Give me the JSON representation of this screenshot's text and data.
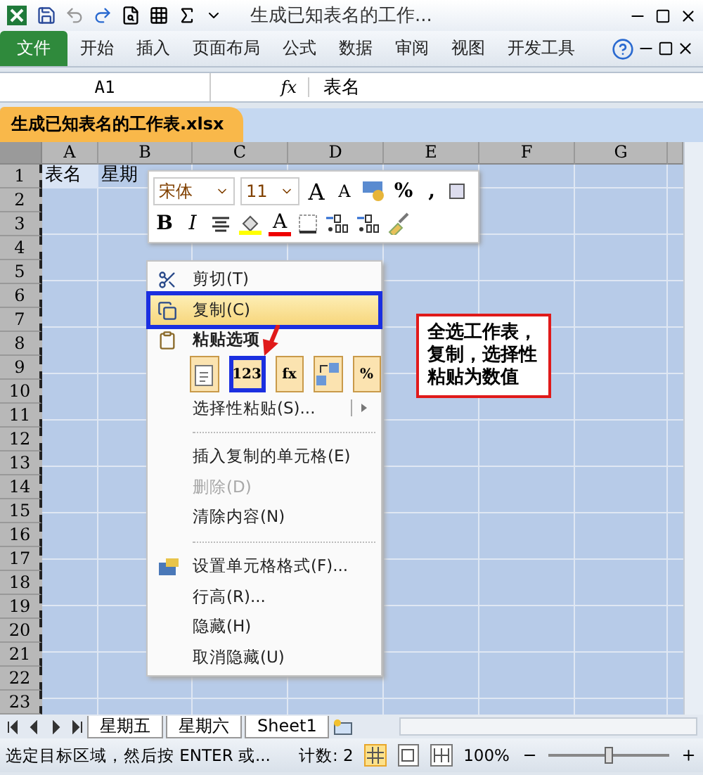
{
  "window": {
    "title": "生成已知表名的工作..."
  },
  "ribbon": {
    "tabs": [
      {
        "label": "文件",
        "kind": "file"
      },
      {
        "label": "开始",
        "kind": "tab"
      },
      {
        "label": "插入",
        "kind": "tab"
      },
      {
        "label": "页面布局",
        "kind": "tab"
      },
      {
        "label": "公式",
        "kind": "tab"
      },
      {
        "label": "数据",
        "kind": "tab"
      },
      {
        "label": "审阅",
        "kind": "tab"
      },
      {
        "label": "视图",
        "kind": "tab"
      },
      {
        "label": "开发工具",
        "kind": "tab"
      }
    ]
  },
  "formula_bar": {
    "name_box": "A1",
    "fx": "fx",
    "value": "表名"
  },
  "workbook_tab": {
    "title": "生成已知表名的工作表.xlsx"
  },
  "sheet": {
    "columns": [
      "A",
      "B",
      "C",
      "D",
      "E",
      "F",
      "G"
    ],
    "rows": [
      {
        "header": "1",
        "cells": [
          "表名",
          "星期"
        ]
      },
      {
        "header": "2"
      },
      {
        "header": "3"
      },
      {
        "header": "4"
      },
      {
        "header": "5"
      },
      {
        "header": "6"
      },
      {
        "header": "7"
      },
      {
        "header": "8"
      },
      {
        "header": "9"
      },
      {
        "header": "10"
      },
      {
        "header": "11"
      },
      {
        "header": "12"
      },
      {
        "header": "13"
      },
      {
        "header": "14"
      },
      {
        "header": "15"
      },
      {
        "header": "16"
      },
      {
        "header": "17"
      },
      {
        "header": "18"
      },
      {
        "header": "19"
      },
      {
        "header": "20"
      },
      {
        "header": "21"
      },
      {
        "header": "22"
      },
      {
        "header": "23"
      }
    ]
  },
  "mini_toolbar": {
    "font": "宋体",
    "size": "11",
    "row_1": [
      {
        "kind": "grow",
        "label": "A"
      },
      {
        "kind": "shrink",
        "label": "A"
      },
      {
        "kind": "accounting"
      },
      {
        "kind": "text",
        "label": "%"
      },
      {
        "kind": "text",
        "label": ","
      },
      {
        "kind": "cut"
      }
    ],
    "row_2": [
      {
        "kind": "bold",
        "label": "B"
      },
      {
        "kind": "italic",
        "label": "I"
      },
      {
        "kind": "center"
      },
      {
        "kind": "fill"
      },
      {
        "kind": "fontcolor",
        "label": "A"
      },
      {
        "kind": "border"
      },
      {
        "kind": "incdec"
      },
      {
        "kind": "decdec"
      },
      {
        "kind": "brush"
      }
    ]
  },
  "context_menu": {
    "items": [
      {
        "kind": "item",
        "label": "剪切(T)",
        "highlighted": false,
        "disabled": false
      },
      {
        "kind": "item",
        "label": "复制(C)",
        "highlighted": true,
        "disabled": false
      },
      {
        "kind": "header",
        "label": "粘贴选项"
      },
      {
        "kind": "paste_options",
        "options": [
          {
            "kind": "paste",
            "selected": false
          },
          {
            "kind": "values",
            "label": "123",
            "selected": true
          },
          {
            "kind": "formulas",
            "label": "fx",
            "selected": false
          },
          {
            "kind": "transpose",
            "selected": false
          },
          {
            "kind": "formatting",
            "label": "%",
            "selected": false
          }
        ]
      },
      {
        "kind": "submenu",
        "label": "选择性粘贴(S)...",
        "highlighted": false,
        "disabled": false
      },
      {
        "kind": "separator"
      },
      {
        "kind": "item",
        "label": "插入复制的单元格(E)",
        "highlighted": false,
        "disabled": false
      },
      {
        "kind": "item",
        "label": "删除(D)",
        "highlighted": false,
        "disabled": true
      },
      {
        "kind": "item",
        "label": "清除内容(N)",
        "highlighted": false,
        "disabled": false
      },
      {
        "kind": "separator"
      },
      {
        "kind": "item",
        "label": "设置单元格格式(F)...",
        "highlighted": false,
        "disabled": false
      },
      {
        "kind": "item",
        "label": "行高(R)...",
        "highlighted": false,
        "disabled": false
      },
      {
        "kind": "item",
        "label": "隐藏(H)",
        "highlighted": false,
        "disabled": false
      },
      {
        "kind": "item",
        "label": "取消隐藏(U)",
        "highlighted": false,
        "disabled": false
      }
    ]
  },
  "callout": {
    "text": "全选工作表，复制，选择性粘贴为数值"
  },
  "sheet_tabs": [
    "星期五",
    "星期六",
    "Sheet1"
  ],
  "status_bar": {
    "message": "选定目标区域，然后按 ENTER 或...",
    "count": "计数: 2",
    "views": [
      {
        "kind": "normal",
        "selected": true
      },
      {
        "kind": "layout",
        "selected": false
      },
      {
        "kind": "break",
        "selected": false
      }
    ],
    "zoom": "100%",
    "zoom_level": {
      "level": 0.5
    }
  }
}
